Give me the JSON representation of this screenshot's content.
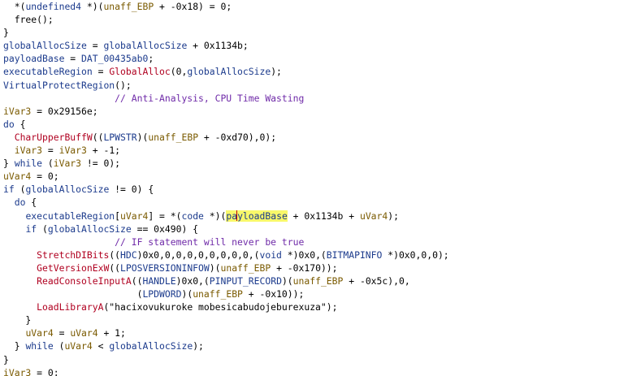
{
  "colors": {
    "plain": "#000000",
    "variable": "#7a5a00",
    "global": "#1b3a8c",
    "type": "#1b3a8c",
    "function": "#b00020",
    "keyword": "#1b3a8c",
    "comment": "#6f2aa8",
    "highlight": "#f8f86a",
    "caret": "#c00000"
  },
  "lines": [
    [
      {
        "t": "  *(",
        "c": "plain"
      },
      {
        "t": "undefined4",
        "c": "type"
      },
      {
        "t": " *)(",
        "c": "plain"
      },
      {
        "t": "unaff_EBP",
        "c": "var"
      },
      {
        "t": " + -0x18) = 0;",
        "c": "plain"
      }
    ],
    [
      {
        "t": "  ",
        "c": "plain"
      },
      {
        "t": "free",
        "c": "plain"
      },
      {
        "t": "();",
        "c": "plain"
      }
    ],
    [
      {
        "t": "}",
        "c": "plain"
      }
    ],
    [
      {
        "t": "globalAllocSize",
        "c": "global"
      },
      {
        "t": " = ",
        "c": "plain"
      },
      {
        "t": "globalAllocSize",
        "c": "global"
      },
      {
        "t": " + 0x1134b;",
        "c": "plain"
      }
    ],
    [
      {
        "t": "payloadBase",
        "c": "global"
      },
      {
        "t": " = ",
        "c": "plain"
      },
      {
        "t": "DAT_00435ab0",
        "c": "global"
      },
      {
        "t": ";",
        "c": "plain"
      }
    ],
    [
      {
        "t": "executableRegion",
        "c": "global"
      },
      {
        "t": " = ",
        "c": "plain"
      },
      {
        "t": "GlobalAlloc",
        "c": "func"
      },
      {
        "t": "(0,",
        "c": "plain"
      },
      {
        "t": "globalAllocSize",
        "c": "global"
      },
      {
        "t": ");",
        "c": "plain"
      }
    ],
    [
      {
        "t": "VirtualProtectRegion",
        "c": "global"
      },
      {
        "t": "();",
        "c": "plain"
      }
    ],
    [
      {
        "t": "                    // Anti-Analysis, CPU Time Wasting",
        "c": "cmt"
      }
    ],
    [
      {
        "t": "iVar3",
        "c": "var"
      },
      {
        "t": " = 0x29156e;",
        "c": "plain"
      }
    ],
    [
      {
        "t": "do",
        "c": "kw"
      },
      {
        "t": " {",
        "c": "plain"
      }
    ],
    [
      {
        "t": "  ",
        "c": "plain"
      },
      {
        "t": "CharUpperBuffW",
        "c": "func"
      },
      {
        "t": "((",
        "c": "plain"
      },
      {
        "t": "LPWSTR",
        "c": "type"
      },
      {
        "t": ")(",
        "c": "plain"
      },
      {
        "t": "unaff_EBP",
        "c": "var"
      },
      {
        "t": " + -0xd70),0);",
        "c": "plain"
      }
    ],
    [
      {
        "t": "  ",
        "c": "plain"
      },
      {
        "t": "iVar3",
        "c": "var"
      },
      {
        "t": " = ",
        "c": "plain"
      },
      {
        "t": "iVar3",
        "c": "var"
      },
      {
        "t": " + -1;",
        "c": "plain"
      }
    ],
    [
      {
        "t": "} ",
        "c": "plain"
      },
      {
        "t": "while",
        "c": "kw"
      },
      {
        "t": " (",
        "c": "plain"
      },
      {
        "t": "iVar3",
        "c": "var"
      },
      {
        "t": " != 0);",
        "c": "plain"
      }
    ],
    [
      {
        "t": "uVar4",
        "c": "var"
      },
      {
        "t": " = 0;",
        "c": "plain"
      }
    ],
    [
      {
        "t": "if",
        "c": "kw"
      },
      {
        "t": " (",
        "c": "plain"
      },
      {
        "t": "globalAllocSize",
        "c": "global"
      },
      {
        "t": " != 0) {",
        "c": "plain"
      }
    ],
    [
      {
        "t": "  ",
        "c": "plain"
      },
      {
        "t": "do",
        "c": "kw"
      },
      {
        "t": " {",
        "c": "plain"
      }
    ],
    [
      {
        "t": "    ",
        "c": "plain"
      },
      {
        "t": "executableRegion",
        "c": "global"
      },
      {
        "t": "[",
        "c": "plain"
      },
      {
        "t": "uVar4",
        "c": "var"
      },
      {
        "t": "] = *(",
        "c": "plain"
      },
      {
        "t": "code",
        "c": "type"
      },
      {
        "t": " *)(",
        "c": "plain"
      },
      {
        "t": "pa",
        "c": "hl"
      },
      {
        "t": "",
        "c": "caret"
      },
      {
        "t": "yloadBase",
        "c": "hl"
      },
      {
        "t": " + 0x1134b + ",
        "c": "plain"
      },
      {
        "t": "uVar4",
        "c": "var"
      },
      {
        "t": ");",
        "c": "plain"
      }
    ],
    [
      {
        "t": "    ",
        "c": "plain"
      },
      {
        "t": "if",
        "c": "kw"
      },
      {
        "t": " (",
        "c": "plain"
      },
      {
        "t": "globalAllocSize",
        "c": "global"
      },
      {
        "t": " == 0x490) {",
        "c": "plain"
      }
    ],
    [
      {
        "t": "                    // IF statement will never be true",
        "c": "cmt"
      }
    ],
    [
      {
        "t": "      ",
        "c": "plain"
      },
      {
        "t": "StretchDIBits",
        "c": "func"
      },
      {
        "t": "((",
        "c": "plain"
      },
      {
        "t": "HDC",
        "c": "type"
      },
      {
        "t": ")0x0,0,0,0,0,0,0,0,0,(",
        "c": "plain"
      },
      {
        "t": "void",
        "c": "type"
      },
      {
        "t": " *)0x0,(",
        "c": "plain"
      },
      {
        "t": "BITMAPINFO",
        "c": "type"
      },
      {
        "t": " *)0x0,0,0);",
        "c": "plain"
      }
    ],
    [
      {
        "t": "      ",
        "c": "plain"
      },
      {
        "t": "GetVersionExW",
        "c": "func"
      },
      {
        "t": "((",
        "c": "plain"
      },
      {
        "t": "LPOSVERSIONINFOW",
        "c": "type"
      },
      {
        "t": ")(",
        "c": "plain"
      },
      {
        "t": "unaff_EBP",
        "c": "var"
      },
      {
        "t": " + -0x170));",
        "c": "plain"
      }
    ],
    [
      {
        "t": "      ",
        "c": "plain"
      },
      {
        "t": "ReadConsoleInputA",
        "c": "func"
      },
      {
        "t": "((",
        "c": "plain"
      },
      {
        "t": "HANDLE",
        "c": "type"
      },
      {
        "t": ")0x0,(",
        "c": "plain"
      },
      {
        "t": "PINPUT_RECORD",
        "c": "type"
      },
      {
        "t": ")(",
        "c": "plain"
      },
      {
        "t": "unaff_EBP",
        "c": "var"
      },
      {
        "t": " + -0x5c),0,",
        "c": "plain"
      }
    ],
    [
      {
        "t": "                        (",
        "c": "plain"
      },
      {
        "t": "LPDWORD",
        "c": "type"
      },
      {
        "t": ")(",
        "c": "plain"
      },
      {
        "t": "unaff_EBP",
        "c": "var"
      },
      {
        "t": " + -0x10));",
        "c": "plain"
      }
    ],
    [
      {
        "t": "      ",
        "c": "plain"
      },
      {
        "t": "LoadLibraryA",
        "c": "func"
      },
      {
        "t": "(\"hacixovukuroke mobesicabudojeburexuza\");",
        "c": "plain"
      }
    ],
    [
      {
        "t": "    }",
        "c": "plain"
      }
    ],
    [
      {
        "t": "    ",
        "c": "plain"
      },
      {
        "t": "uVar4",
        "c": "var"
      },
      {
        "t": " = ",
        "c": "plain"
      },
      {
        "t": "uVar4",
        "c": "var"
      },
      {
        "t": " + 1;",
        "c": "plain"
      }
    ],
    [
      {
        "t": "  } ",
        "c": "plain"
      },
      {
        "t": "while",
        "c": "kw"
      },
      {
        "t": " (",
        "c": "plain"
      },
      {
        "t": "uVar4",
        "c": "var"
      },
      {
        "t": " < ",
        "c": "plain"
      },
      {
        "t": "globalAllocSize",
        "c": "global"
      },
      {
        "t": ");",
        "c": "plain"
      }
    ],
    [
      {
        "t": "}",
        "c": "plain"
      }
    ],
    [
      {
        "t": "iVar3",
        "c": "var"
      },
      {
        "t": " = 0;",
        "c": "plain"
      }
    ]
  ]
}
